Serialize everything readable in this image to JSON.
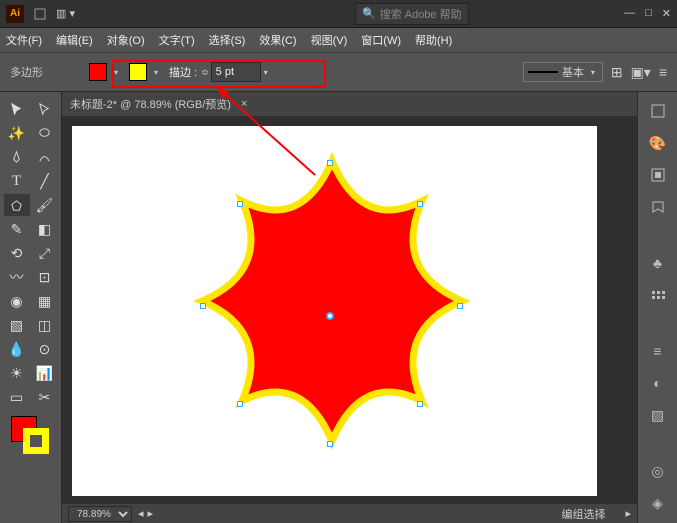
{
  "title": {
    "app": "Ai"
  },
  "search": {
    "icon": "🔍",
    "placeholder": "搜索 Adobe 帮助"
  },
  "menu": {
    "file": "文件(F)",
    "edit": "编辑(E)",
    "object": "对象(O)",
    "type": "文字(T)",
    "select": "选择(S)",
    "effect": "效果(C)",
    "view": "视图(V)",
    "window": "窗口(W)",
    "help": "帮助(H)"
  },
  "control": {
    "shape": "多边形",
    "stroke_label": "描边 :",
    "stroke_val": "5 pt",
    "style": "基本",
    "fill_color": "#ff0000",
    "stroke_color": "#ffff00"
  },
  "doc": {
    "tab": "未标题-2* @ 78.89% (RGB/预览)",
    "close": "×"
  },
  "status": {
    "zoom": "78.89%",
    "sel": "编组选择"
  },
  "chart_data": {
    "type": "vector-shape",
    "shape": "8-point-concave-star",
    "fill": "#ff0000",
    "stroke": "#ffff00",
    "stroke_width_pt": 5,
    "outer_radius_px": 170,
    "inner_radius_px": 120,
    "center": [
      258,
      190
    ],
    "selection_handles": 8
  }
}
